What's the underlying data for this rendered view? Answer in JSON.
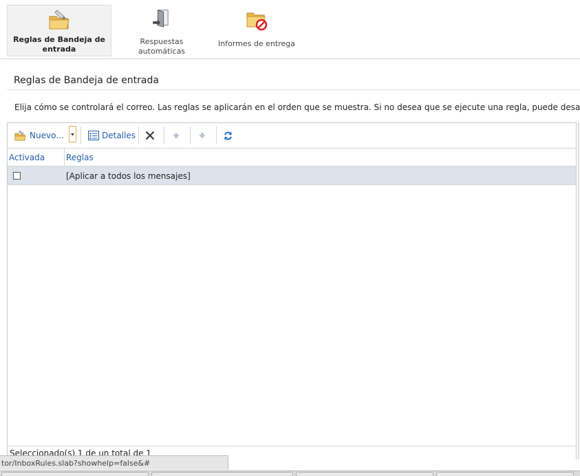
{
  "ribbon": {
    "tabs": [
      {
        "label": "Reglas de Bandeja de entrada",
        "icon": "inbox-rules-folder-icon"
      },
      {
        "label": "Respuestas automáticas",
        "icon": "auto-reply-door-icon"
      },
      {
        "label": "Informes de entrega",
        "icon": "delivery-report-folder-icon"
      }
    ]
  },
  "page": {
    "title": "Reglas de Bandeja de entrada",
    "description": "Elija cómo se controlará el correo. Las reglas se aplicarán en el orden que se muestra. Si no desea que se ejecute una regla, puede desactiva"
  },
  "toolbar": {
    "new_label": "Nuevo...",
    "details_label": "Detalles"
  },
  "grid": {
    "columns": [
      "Activada",
      "Reglas"
    ],
    "rows": [
      {
        "enabled": false,
        "rule": "[Aplicar a todos los mensajes]"
      }
    ],
    "footer": "Seleccionado(s) 1 de un total de 1"
  },
  "statusbar": {
    "url": "tor/InboxRules.slab?showhelp=false&#"
  },
  "colors": {
    "accent": "#1f5fa8",
    "row_selected": "#dde3ea"
  }
}
